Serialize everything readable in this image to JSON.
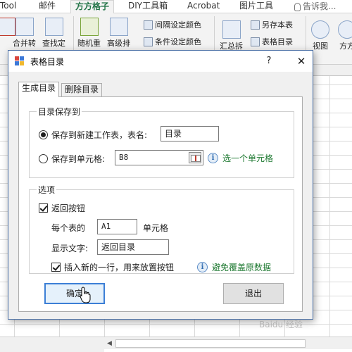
{
  "ribbon": {
    "tabs": [
      {
        "label": "Tool"
      },
      {
        "label": "邮件"
      },
      {
        "label": "方方格子"
      },
      {
        "label": "DIY工具箱"
      },
      {
        "label": "Acrobat"
      },
      {
        "label": "图片工具"
      },
      {
        "label": "告诉我..."
      }
    ],
    "buttons": {
      "merge": "合并转",
      "find": "查找定",
      "random": "随机重",
      "advsort": "高级排",
      "interval_color": "间隔设定颜色",
      "condition_color": "条件设定颜色",
      "summary": "汇总拆",
      "save_as": "另存本表",
      "sheet_dir": "表格目录",
      "view": "视图",
      "fangfang": "方方"
    }
  },
  "dialog": {
    "title": "表格目录",
    "help": "?",
    "close": "✕",
    "tabs": [
      "生成目录",
      "删除目录"
    ],
    "save_group": {
      "label": "目录保存到",
      "option_new_sheet": "保存到新建工作表，表名:",
      "new_sheet_name": "目录",
      "option_cell": "保存到单元格:",
      "cell_ref": "B8",
      "cell_hint": "选一个单元格"
    },
    "options_group": {
      "label": "选项",
      "return_button": "返回按钮",
      "per_sheet_label": "每个表的",
      "per_sheet_cell": "A1",
      "cell_suffix": "单元格",
      "display_text_label": "显示文字:",
      "display_text": "返回目录",
      "insert_row": "插入新的一行，用来放置按钮",
      "insert_hint": "避免覆盖原数据"
    },
    "ok": "确定",
    "exit": "退出"
  },
  "watermark": "Baidu 经验"
}
